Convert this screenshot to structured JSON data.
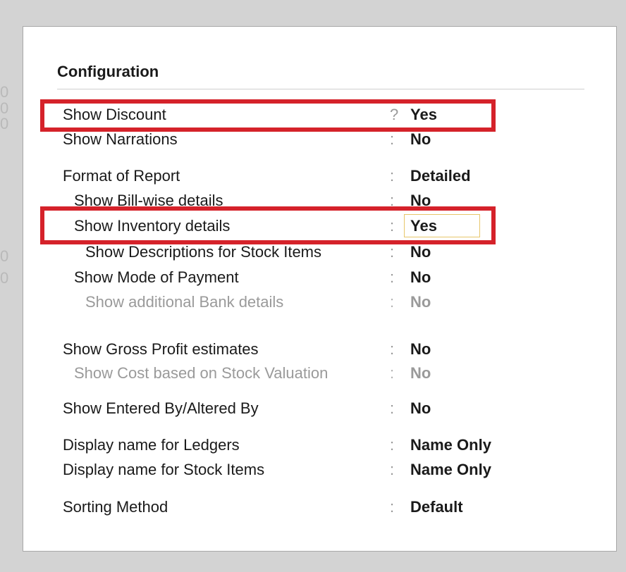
{
  "background": {
    "digits": [
      "0",
      "0",
      "0",
      "0",
      "0"
    ]
  },
  "dialog": {
    "title": "Configuration"
  },
  "items": [
    {
      "label": "Show Discount",
      "sep": "?",
      "value": "Yes"
    },
    {
      "label": "Show Narrations",
      "sep": ":",
      "value": "No"
    },
    {
      "label": "Format of Report",
      "sep": ":",
      "value": "Detailed"
    },
    {
      "label": "Show Bill-wise details",
      "sep": ":",
      "value": "No"
    },
    {
      "label": "Show Inventory details",
      "sep": ":",
      "value": "Yes"
    },
    {
      "label": "Show Descriptions for Stock Items",
      "sep": ":",
      "value": "No"
    },
    {
      "label": "Show Mode of Payment",
      "sep": ":",
      "value": "No"
    },
    {
      "label": "Show additional Bank details",
      "sep": ":",
      "value": "No"
    },
    {
      "label": "Show Gross Profit estimates",
      "sep": ":",
      "value": "No"
    },
    {
      "label": "Show Cost based on Stock Valuation",
      "sep": ":",
      "value": "No"
    },
    {
      "label": "Show Entered By/Altered By",
      "sep": ":",
      "value": "No"
    },
    {
      "label": "Display name for Ledgers",
      "sep": ":",
      "value": "Name Only"
    },
    {
      "label": "Display name for Stock Items",
      "sep": ":",
      "value": "Name Only"
    },
    {
      "label": "Sorting Method",
      "sep": ":",
      "value": "Default"
    }
  ],
  "colors": {
    "highlight": "#d5222a",
    "focus": "#e7c66a",
    "disabled_text": "#9a9a9a"
  }
}
